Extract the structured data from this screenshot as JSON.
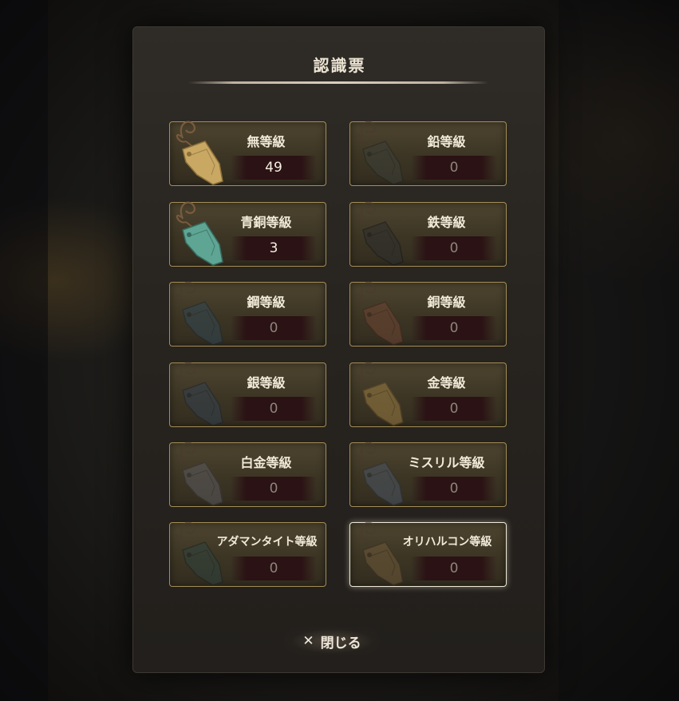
{
  "title": "認識票",
  "close_label": "閉じる",
  "close_icon_glyph": "✕",
  "tags": [
    {
      "name": "無等級",
      "count": "49",
      "color": "#c9a864",
      "dark": "#8e7038",
      "cord": "#7a5b3e",
      "dim": false
    },
    {
      "name": "鉛等級",
      "count": "0",
      "color": "#3d4039",
      "dark": "#25271f",
      "cord": "#4a3a2e",
      "dim": true
    },
    {
      "name": "青銅等級",
      "count": "3",
      "color": "#5fa594",
      "dark": "#356a5f",
      "cord": "#7a5b3e",
      "dim": false
    },
    {
      "name": "鉄等級",
      "count": "0",
      "color": "#2e2f2f",
      "dark": "#18191a",
      "cord": "#4a3a2e",
      "dim": true
    },
    {
      "name": "鋼等級",
      "count": "0",
      "color": "#334853",
      "dark": "#1e2b33",
      "cord": "#4a3a2e",
      "dim": true
    },
    {
      "name": "銅等級",
      "count": "0",
      "color": "#6e4634",
      "dark": "#44281d",
      "cord": "#4a3a2e",
      "dim": true
    },
    {
      "name": "銀等級",
      "count": "0",
      "color": "#34414f",
      "dark": "#1e2631",
      "cord": "#4a3a2e",
      "dim": true
    },
    {
      "name": "金等級",
      "count": "0",
      "color": "#9c7e44",
      "dark": "#5e4a25",
      "cord": "#4a3a2e",
      "dim": true
    },
    {
      "name": "白金等級",
      "count": "0",
      "color": "#5c5a5e",
      "dark": "#38363a",
      "cord": "#4a3a2e",
      "dim": true
    },
    {
      "name": "ミスリル等級",
      "count": "0",
      "color": "#4c5664",
      "dark": "#2c333c",
      "cord": "#4a3a2e",
      "dim": true
    },
    {
      "name": "アダマンタイト等級",
      "count": "0",
      "color": "#30433e",
      "dark": "#1b2623",
      "cord": "#4a3a2e",
      "dim": true
    },
    {
      "name": "オリハルコン等級",
      "count": "0",
      "color": "#6e5a3a",
      "dark": "#3e3222",
      "cord": "#4a3a2e",
      "dim": true
    }
  ]
}
